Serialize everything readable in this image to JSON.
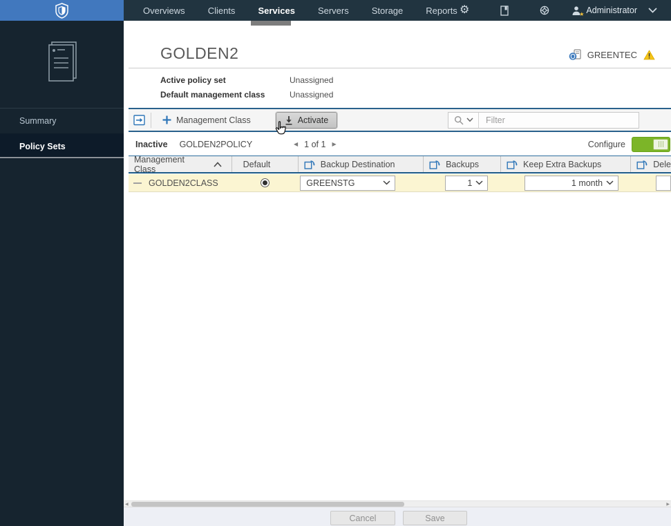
{
  "nav": {
    "items": [
      {
        "label": "Overviews"
      },
      {
        "label": "Clients"
      },
      {
        "label": "Services"
      },
      {
        "label": "Servers"
      },
      {
        "label": "Storage"
      },
      {
        "label": "Reports"
      }
    ],
    "active_item": "Services",
    "user_label": "Administrator",
    "icons": [
      "gear-icon",
      "book-icon",
      "help-ring-icon",
      "user-icon",
      "chevron-down-icon"
    ]
  },
  "sidebar": {
    "items": [
      {
        "label": "Summary"
      },
      {
        "label": "Policy Sets"
      }
    ],
    "active_item": "Policy Sets"
  },
  "header": {
    "title": "GOLDEN2",
    "server_name": "GREENTEC",
    "has_warning": true,
    "details": [
      {
        "label": "Active policy set",
        "value": "Unassigned"
      },
      {
        "label": "Default management class",
        "value": "Unassigned"
      }
    ]
  },
  "toolbar": {
    "management_class_label": "Management Class",
    "activate_label": "Activate",
    "filter_placeholder": "Filter",
    "filter_value": ""
  },
  "policy_bar": {
    "status": "Inactive",
    "policy_name": "GOLDEN2POLICY",
    "page_label": "1 of 1",
    "configure_label": "Configure",
    "configure_toggle_on": true
  },
  "table": {
    "columns": [
      {
        "label": "Management Class",
        "sort": "asc"
      },
      {
        "label": "Default"
      },
      {
        "label": "Backup Destination",
        "apply_all_icon": true
      },
      {
        "label": "Backups",
        "apply_all_icon": true
      },
      {
        "label": "Keep Extra Backups",
        "apply_all_icon": true
      },
      {
        "label": "Dele",
        "apply_all_icon": true,
        "truncated_by_viewport": true
      }
    ],
    "rows": [
      {
        "name": "GOLDEN2CLASS",
        "is_default_selected": true,
        "backup_destination": "GREENSTG",
        "backups": "1",
        "keep_extra_backups": "1 month",
        "modified_highlight": true
      }
    ]
  },
  "footer": {
    "cancel_label": "Cancel",
    "save_label": "Save"
  },
  "colors": {
    "nav_bg": "#213440",
    "sidebar_bg": "#16242f",
    "logo_blue": "#4178be",
    "accent_blue": "#2e76b8",
    "toolbar_border": "#29618c",
    "row_highlight": "#fbf5d2",
    "toggle_green": "#7cb528",
    "warning_yellow": "#f5c518"
  }
}
